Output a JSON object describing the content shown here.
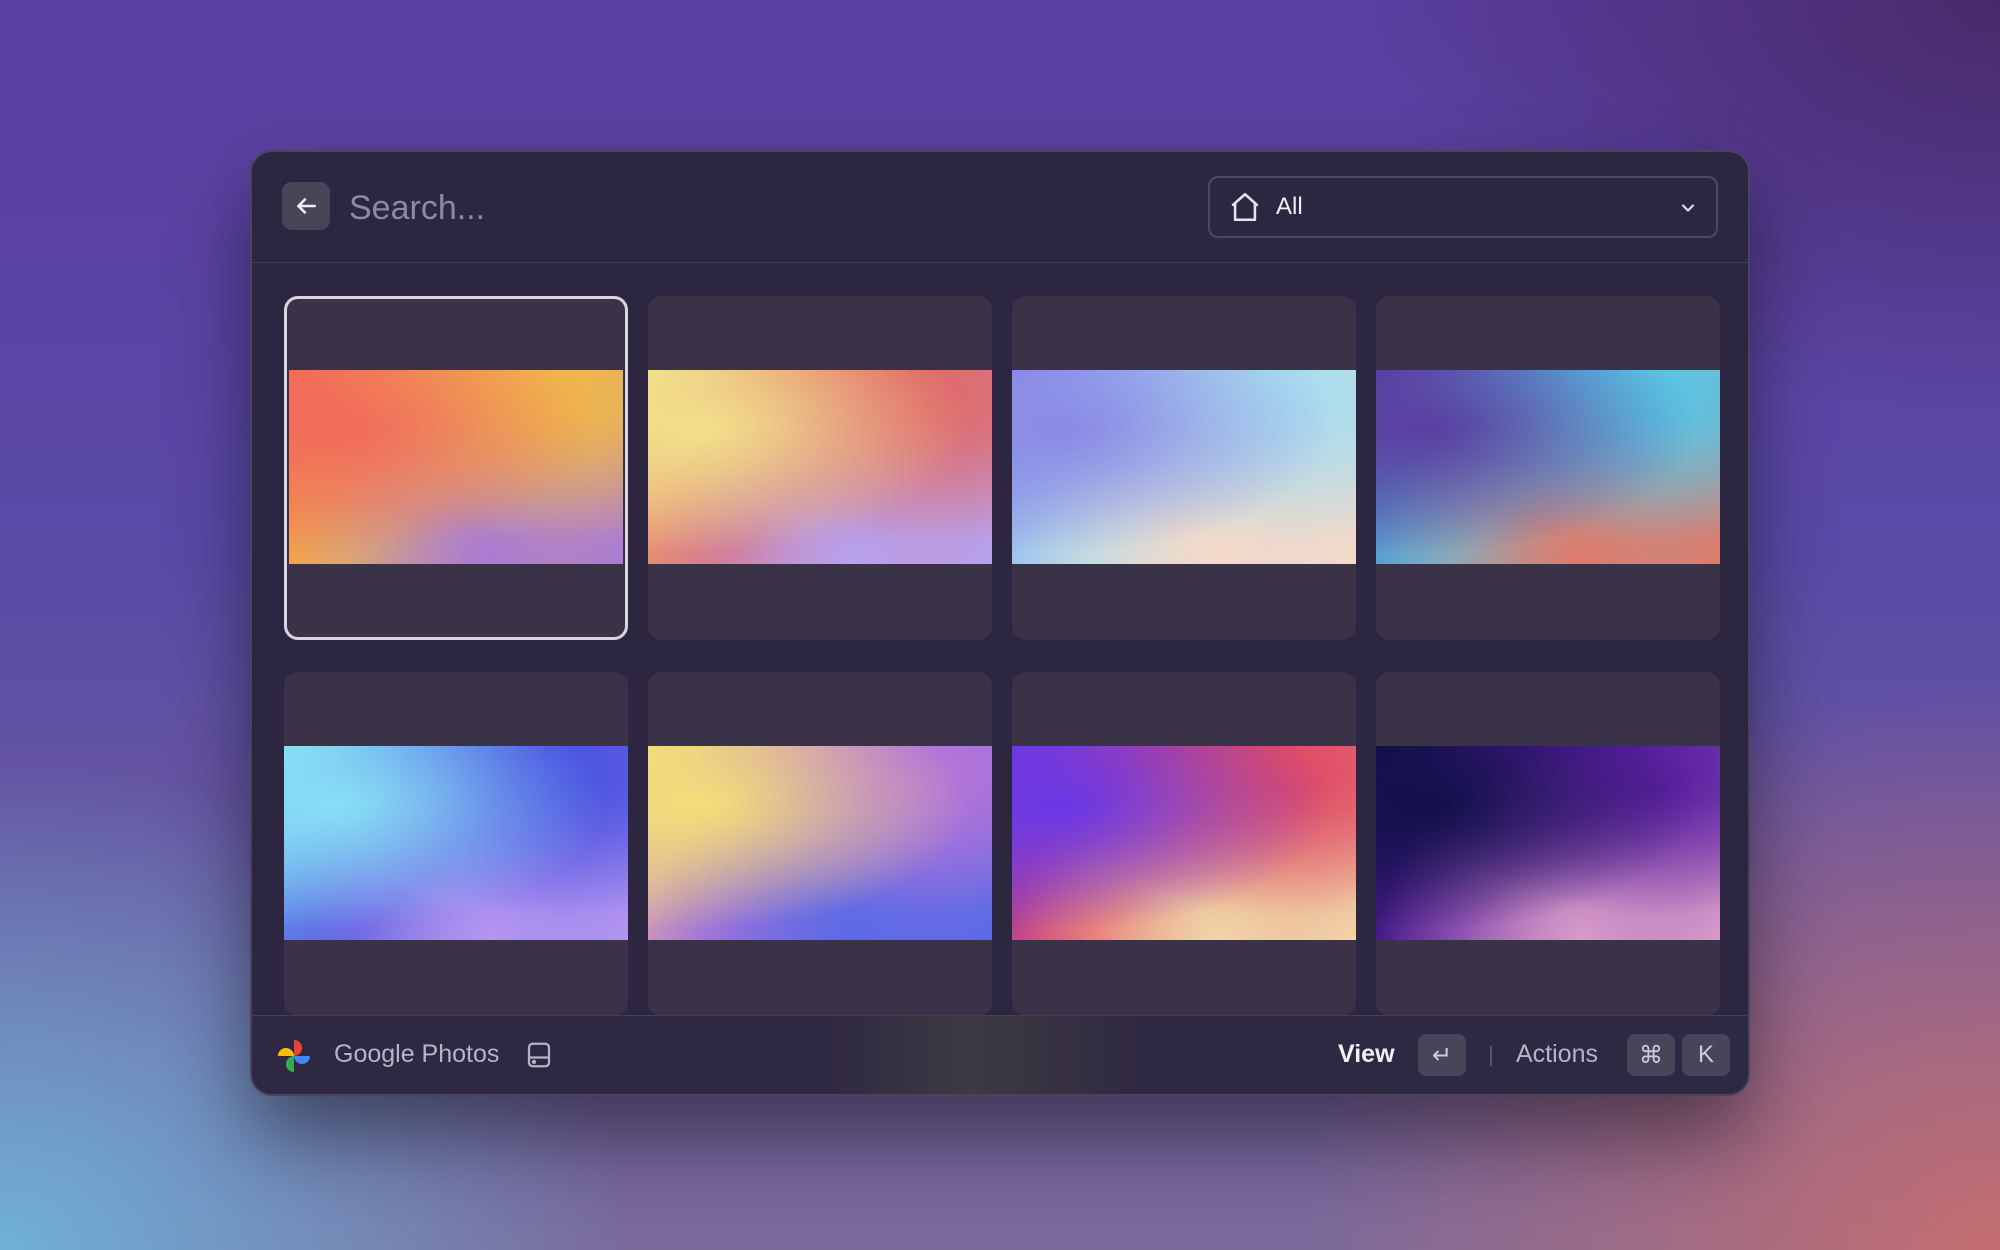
{
  "search": {
    "placeholder": "Search..."
  },
  "filter": {
    "selected": "All",
    "icon": "home-icon"
  },
  "photos": [
    {
      "name": "gradient-1",
      "selected": true,
      "colors": [
        "#f26b5b",
        "#f0b84a",
        "#a97bd6"
      ]
    },
    {
      "name": "gradient-2",
      "selected": false,
      "colors": [
        "#f2e08a",
        "#e06a6a",
        "#b6a2f0"
      ]
    },
    {
      "name": "gradient-3",
      "selected": false,
      "colors": [
        "#8a8ae6",
        "#a8dcef",
        "#f5d9c8"
      ]
    },
    {
      "name": "gradient-4",
      "selected": false,
      "colors": [
        "#5a3fa0",
        "#58c6e6",
        "#e07a6a"
      ]
    },
    {
      "name": "gradient-5",
      "selected": false,
      "colors": [
        "#88e0f5",
        "#4a52e0",
        "#b596f0"
      ]
    },
    {
      "name": "gradient-6",
      "selected": false,
      "colors": [
        "#f5dd78",
        "#b574d8",
        "#5a6ae6"
      ]
    },
    {
      "name": "gradient-7",
      "selected": false,
      "colors": [
        "#6a38e6",
        "#e04a64",
        "#f0d6a6"
      ]
    },
    {
      "name": "gradient-8",
      "selected": false,
      "colors": [
        "#12104a",
        "#5a1fa0",
        "#d79ac8"
      ]
    }
  ],
  "footer": {
    "app_name": "Google Photos",
    "primary_action": "View",
    "primary_key": "↵",
    "secondary_action": "Actions",
    "secondary_keys": [
      "⌘",
      "K"
    ]
  }
}
